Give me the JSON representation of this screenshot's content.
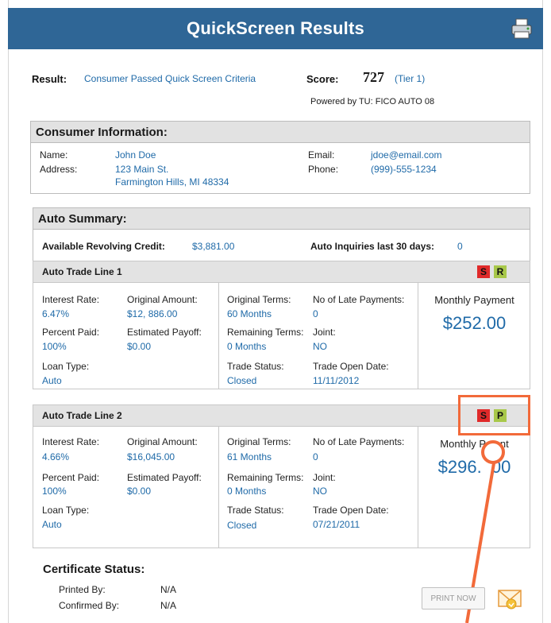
{
  "header": {
    "title": "QuickScreen Results",
    "print_icon": "printer-icon"
  },
  "result": {
    "label": "Result:",
    "value": "Consumer Passed Quick Screen Criteria",
    "score_label": "Score:",
    "score": "727",
    "tier": "(Tier 1)",
    "powered_by": "Powered by TU: FICO AUTO 08"
  },
  "consumer": {
    "heading": "Consumer Information:",
    "name_label": "Name:",
    "name": "John Doe",
    "address_label": "Address:",
    "address_line1": "123 Main St.",
    "address_line2": "Farmington Hills, MI 48334",
    "email_label": "Email:",
    "email": "jdoe@email.com",
    "phone_label": "Phone:",
    "phone": "(999)-555-1234"
  },
  "auto_summary": {
    "heading": "Auto Summary:",
    "credit_label": "Available Revolving Credit:",
    "credit_value": "$3,881.00",
    "inquiries_label": "Auto Inquiries last 30 days:",
    "inquiries_value": "0"
  },
  "trade_lines": [
    {
      "title": "Auto Trade Line 1",
      "badges": [
        "S",
        "R"
      ],
      "interest_label": "Interest Rate:",
      "interest": "6.47%",
      "orig_amount_label": "Original Amount:",
      "orig_amount": "$12, 886.00",
      "orig_terms_label": "Original Terms:",
      "orig_terms": "60 Months",
      "late_label": "No of Late Payments:",
      "late": "0",
      "percent_label": "Percent Paid:",
      "percent": "100%",
      "payoff_label": "Estimated Payoff:",
      "payoff": "$0.00",
      "remaining_label": "Remaining Terms:",
      "remaining": "0 Months",
      "joint_label": "Joint:",
      "joint": "NO",
      "loan_type_label": "Loan Type:",
      "loan_type": "Auto",
      "status_label": "Trade Status:",
      "status": "Closed",
      "open_date_label": "Trade Open Date:",
      "open_date": "11/11/2012",
      "monthly_label": "Monthly Payment",
      "monthly": "$252.00"
    },
    {
      "title": "Auto Trade Line 2",
      "badges": [
        "S",
        "P"
      ],
      "interest_label": "Interest Rate:",
      "interest": "4.66%",
      "orig_amount_label": "Original Amount:",
      "orig_amount": "$16,045.00",
      "orig_terms_label": "Original Terms:",
      "orig_terms": "61 Months",
      "late_label": "No of Late Payments:",
      "late": "0",
      "percent_label": "Percent Paid:",
      "percent": "100%",
      "payoff_label": "Estimated Payoff:",
      "payoff": "$0.00",
      "remaining_label": "Remaining Terms:",
      "remaining": "0 Months",
      "joint_label": "Joint:",
      "joint": "NO",
      "loan_type_label": "Loan Type:",
      "loan_type": "Auto",
      "status_label": "Trade Status:",
      "status": "Closed",
      "open_date_label": "Trade Open Date:",
      "open_date": "07/21/2011",
      "monthly_label": "Monthly P     nt",
      "monthly": "$296.  00"
    }
  ],
  "certificate": {
    "heading": "Certificate Status:",
    "printed_label": "Printed By:",
    "printed": "N/A",
    "confirmed_label": "Confirmed By:",
    "confirmed": "N/A"
  },
  "actions": {
    "print_now": "PRINT NOW",
    "email_icon": "envelope-icon"
  },
  "colors": {
    "header": "#2f6696",
    "link": "#1f6aa8",
    "annotation": "#f26a3a",
    "badge_s": "#e02a2a",
    "badge_g": "#a8c84a"
  }
}
